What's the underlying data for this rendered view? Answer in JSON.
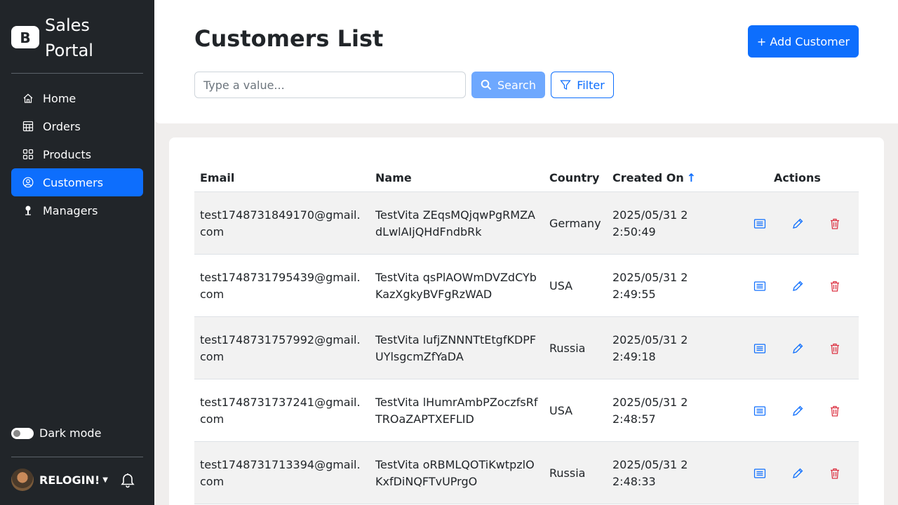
{
  "sidebar": {
    "brand": "Sales Portal",
    "items": [
      {
        "label": "Home",
        "icon": "house-icon",
        "active": false
      },
      {
        "label": "Orders",
        "icon": "table-icon",
        "active": false
      },
      {
        "label": "Products",
        "icon": "grid-icon",
        "active": false
      },
      {
        "label": "Customers",
        "icon": "person-circle-icon",
        "active": true
      },
      {
        "label": "Managers",
        "icon": "person-icon",
        "active": false
      }
    ],
    "dark_mode_label": "Dark mode",
    "user_name": "RELOGIN!"
  },
  "header": {
    "title": "Customers List",
    "add_button": "+ Add Customer",
    "search_placeholder": "Type a value...",
    "search_button": "Search",
    "filter_button": "Filter"
  },
  "table": {
    "columns": [
      "Email",
      "Name",
      "Country",
      "Created On",
      "Actions"
    ],
    "sort_indicator": "↑",
    "rows": [
      {
        "email": "test1748731849170@gmail.com",
        "name": "TestVita ZEqsMQjqwPgRMZAdLwlAIjQHdFndbRk",
        "country": "Germany",
        "created": "2025/05/31 22:50:49"
      },
      {
        "email": "test1748731795439@gmail.com",
        "name": "TestVita qsPlAOWmDVZdCYbKazXgkyBVFgRzWAD",
        "country": "USA",
        "created": "2025/05/31 22:49:55"
      },
      {
        "email": "test1748731757992@gmail.com",
        "name": "TestVita lufjZNNNTtEtgfKDPFUYlsgcmZfYaDA",
        "country": "Russia",
        "created": "2025/05/31 22:49:18"
      },
      {
        "email": "test1748731737241@gmail.com",
        "name": "TestVita lHumrAmbPZoczfsRfTROaZAPTXEFLID",
        "country": "USA",
        "created": "2025/05/31 22:48:57"
      },
      {
        "email": "test1748731713394@gmail.com",
        "name": "TestVita oRBMLQOTiKwtpzlOKxfDiNQFTvUPrgO",
        "country": "Russia",
        "created": "2025/05/31 22:48:33"
      }
    ]
  },
  "colors": {
    "primary": "#0d6efd",
    "danger": "#dc3545",
    "sidebar_bg": "#212529"
  }
}
